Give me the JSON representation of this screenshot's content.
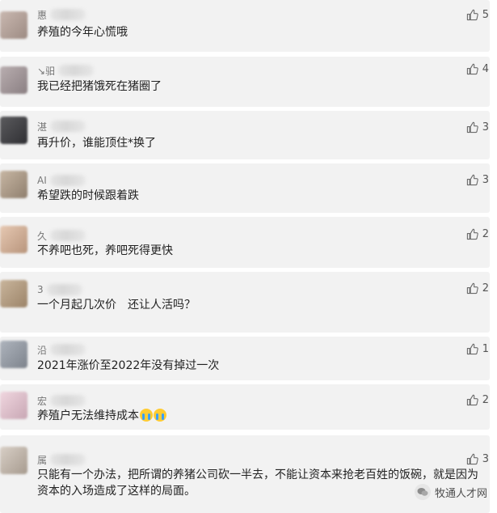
{
  "comments": [
    {
      "name": "惠",
      "text": "养殖的今年心慌哦",
      "likes": "5",
      "avatar_colors": [
        "#c9b8b0",
        "#9d8b83"
      ]
    },
    {
      "name": "↘驲",
      "text": "我已经把猪饿死在猪圈了",
      "likes": "4",
      "avatar_colors": [
        "#b9aeb0",
        "#8a7f82"
      ]
    },
    {
      "name": "湛",
      "text": "再升价，谁能顶住*换了",
      "likes": "3",
      "avatar_colors": [
        "#5b5b5e",
        "#2f2f33"
      ]
    },
    {
      "name": "AI",
      "text": "希望跌的时候跟着跌",
      "likes": "3",
      "avatar_colors": [
        "#c7b6a3",
        "#8f7f6e"
      ]
    },
    {
      "name": "久",
      "text": "不养吧也死，养吧死得更快",
      "likes": "2",
      "avatar_colors": [
        "#e6c8b2",
        "#b8957c"
      ]
    },
    {
      "name": "3",
      "text": "一个月起几次价　还让人活吗？",
      "likes": "2",
      "avatar_colors": [
        "#c9b59c",
        "#9c8469"
      ]
    },
    {
      "name": "沿",
      "text": "2021年涨价至2022年没有掉过一次",
      "likes": "1",
      "avatar_colors": [
        "#aeb4bd",
        "#7d838c"
      ]
    },
    {
      "name": "宏",
      "text": "养殖户无法维持成本",
      "likes": "2",
      "emoji_count": 2,
      "avatar_colors": [
        "#f0d6df",
        "#c8a7b4"
      ]
    },
    {
      "name": "属",
      "text": "只能有一个办法，把所谓的养猪公司砍一半去，不能让资本来抢老百姓的饭碗，就是因为资本的入场造成了这样的局面。",
      "likes": "3",
      "avatar_colors": [
        "#d8cfc6",
        "#a79b8f"
      ]
    }
  ],
  "watermark": {
    "text": "牧通人才网",
    "icon": "wechat-icon"
  }
}
